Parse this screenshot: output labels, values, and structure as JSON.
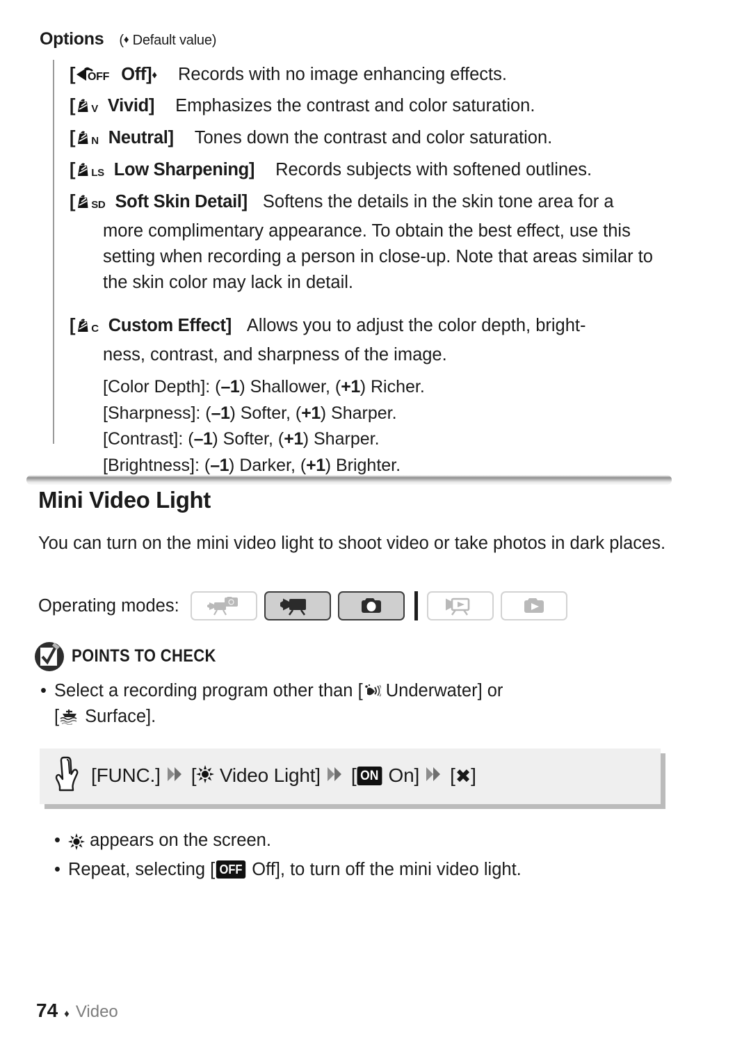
{
  "options": {
    "header_title": "Options",
    "header_note_open": "(",
    "header_note_text": " Default value)",
    "items": [
      {
        "icon": "effect-off-icon",
        "tag": "Off]",
        "tag_open": "[",
        "default_marker": true,
        "desc": "Records with no image enhancing effects."
      },
      {
        "icon": "effect-vivid-icon",
        "icon_sub": "V",
        "tag_open": "[",
        "tag": "Vivid]",
        "default_marker": false,
        "desc": "Emphasizes the contrast and color saturation."
      },
      {
        "icon": "effect-neutral-icon",
        "icon_sub": "N",
        "tag_open": "[",
        "tag": "Neutral]",
        "default_marker": false,
        "desc": "Tones down the contrast and color saturation."
      },
      {
        "icon": "effect-low-sharpening-icon",
        "icon_sub": "LS",
        "tag_open": "[",
        "tag": "Low Sharpening]",
        "default_marker": false,
        "desc": "Records subjects with softened outlines."
      },
      {
        "icon": "effect-soft-skin-detail-icon",
        "icon_sub": "SD",
        "tag_open": "[",
        "tag": "Soft Skin Detail]",
        "default_marker": false,
        "desc": "Softens the details in the skin tone area for a",
        "body": "more complimentary appearance. To obtain the best effect, use this setting when recording a person in close-up. Note that areas similar to the skin color may lack in detail."
      },
      {
        "icon": "effect-custom-icon",
        "icon_sub": "C",
        "tag_open": "[",
        "tag": "Custom Effect]",
        "default_marker": false,
        "desc": "Allows you to adjust the color depth, bright-",
        "body": "ness, contrast, and sharpness of the image.",
        "sub_items": [
          {
            "label": "[Color Depth]: (",
            "minus": "–1",
            "mid": ") Shallower, (",
            "plus": "+1",
            "end": ") Richer."
          },
          {
            "label": "[Sharpness]: (",
            "minus": "–1",
            "mid": ") Softer, (",
            "plus": "+1",
            "end": ") Sharper."
          },
          {
            "label": "[Contrast]: (",
            "minus": "–1",
            "mid": ") Softer, (",
            "plus": "+1",
            "end": ") Sharper."
          },
          {
            "label": "[Brightness]: (",
            "minus": "–1",
            "mid": ") Darker, (",
            "plus": "+1",
            "end": ") Brighter."
          }
        ]
      }
    ]
  },
  "mini_video_light": {
    "heading": "Mini Video Light",
    "intro": "You can turn on the mini video light to shoot video or take photos in dark places.",
    "operating_modes_label": "Operating modes:",
    "modes": [
      {
        "name": "dual-shot-mode",
        "state": "off",
        "icon": "camcorder-photo-icon"
      },
      {
        "name": "video-record-mode",
        "state": "on",
        "icon": "camcorder-icon"
      },
      {
        "name": "photo-record-mode",
        "state": "on",
        "icon": "camera-icon"
      },
      {
        "name": "video-playback-mode",
        "state": "off",
        "icon": "camcorder-playback-icon"
      },
      {
        "name": "photo-playback-mode",
        "state": "off",
        "icon": "photo-playback-icon"
      }
    ]
  },
  "points_to_check": {
    "title": "POINTS TO CHECK",
    "bullets": [
      {
        "pre": "Select a recording program other than [",
        "icon": "underwater-icon",
        "mid": " Underwater] or",
        "line2_pre": "[",
        "line2_icon": "surface-icon",
        "line2_post": " Surface]."
      }
    ]
  },
  "procedure": {
    "hand_icon": "pointing-hand-icon",
    "step1": "[FUNC.]",
    "step2_open": "[",
    "step2_icon": "video-light-icon",
    "step2_label": " Video Light]",
    "step3_open": "[",
    "step3_badge": "ON",
    "step3_label": " On]",
    "step4_open": "[",
    "step4_glyph": "✖",
    "step4_close": "]",
    "chevron_icon": "double-chevron-right-icon"
  },
  "notes": [
    {
      "icon": "video-light-icon",
      "text": " appears on the screen."
    },
    {
      "pre": "Repeat, selecting [",
      "badge": "OFF",
      "post": " Off], to turn off the mini video light."
    }
  ],
  "footer": {
    "page_number": "74",
    "diamond": "♦",
    "section": "Video"
  },
  "colors": {
    "text": "#1a1a1a",
    "rule": "#9a9a9a",
    "mode_on_fill": "#cfcfcf",
    "mode_on_border": "#3b3b3b",
    "mode_off_border": "#d2d2d2",
    "func_box_bg": "#efefef",
    "badge_bg": "#101010",
    "footer_section": "#7d7d7d"
  }
}
